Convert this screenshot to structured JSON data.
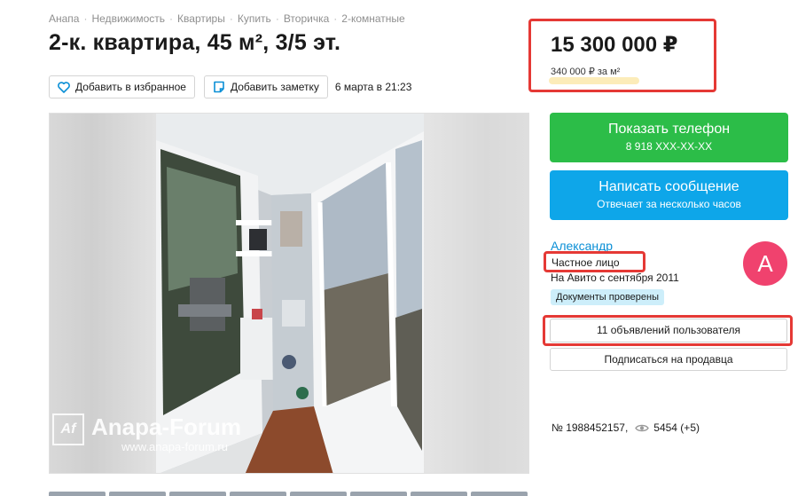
{
  "breadcrumb": [
    "Анапа",
    "Недвижимость",
    "Квартиры",
    "Купить",
    "Вторичка",
    "2-комнатные"
  ],
  "title": "2-к. квартира, 45 м², 3/5 эт.",
  "actions": {
    "favorite_label": "Добавить в избранное",
    "note_label": "Добавить заметку",
    "date": "6 марта в 21:23"
  },
  "price": {
    "value": "15 300 000 ",
    "currency_glyph": "₽",
    "per_m2": "340 000 ₽ за м²"
  },
  "watermark": {
    "logo": "Af",
    "name": "Anapa-Forum",
    "url": "www.anapa-forum.ru"
  },
  "contact": {
    "phone_button": "Показать телефон",
    "phone_number": "8 918 XXX-XX-XX",
    "message_button": "Написать сообщение",
    "message_sub": "Отвечает за несколько часов"
  },
  "seller": {
    "name": "Александр",
    "type": "Частное лицо",
    "since": "На Авито с сентября 2011",
    "docs_badge": "Документы проверены",
    "avatar_letter": "А",
    "avatar_color": "#f0426e"
  },
  "seller_actions": {
    "listings": "11 объявлений пользователя",
    "subscribe": "Подписаться на продавца"
  },
  "meta": {
    "ad_number": "№ 1988452157,",
    "views": "5454 (+5)"
  },
  "colors": {
    "accent_green": "#2cbd48",
    "accent_blue": "#0ea6e9",
    "highlight_red": "#e53935",
    "link": "#0a8fd6"
  }
}
